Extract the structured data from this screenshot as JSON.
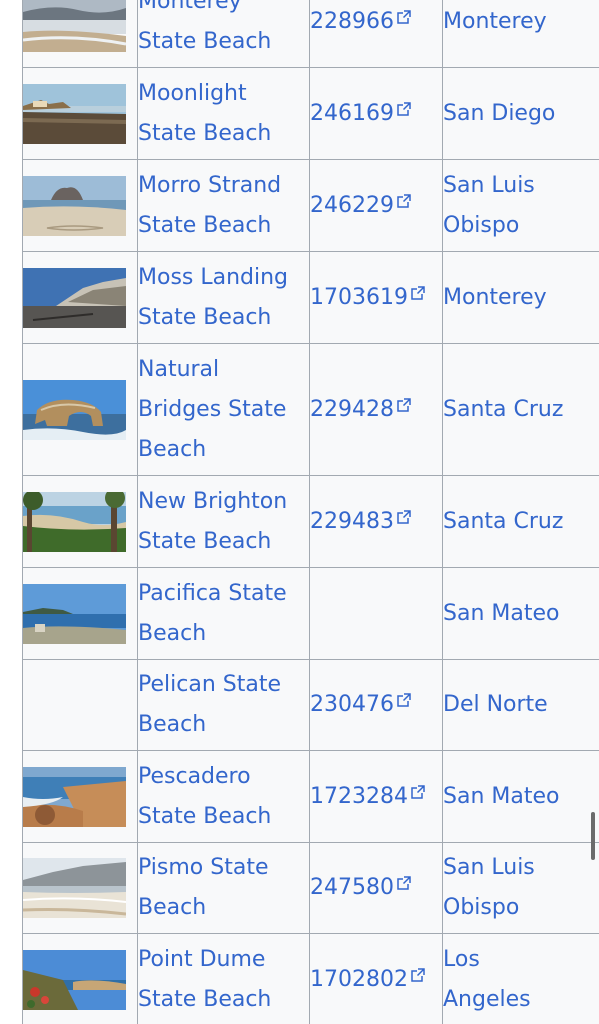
{
  "table": {
    "rows": [
      {
        "name": "Monterey State Beach",
        "name_lines": [
          "Monterey",
          "State Beach"
        ],
        "id": "228966",
        "county_lines": [
          "Monterey"
        ],
        "image": "monterey-beach-photo"
      },
      {
        "name": "Moonlight State Beach",
        "name_lines": [
          "Moonlight",
          "State Beach"
        ],
        "id": "246169",
        "county_lines": [
          "San Diego"
        ],
        "image": "moonlight-beach-photo"
      },
      {
        "name": "Morro Strand State Beach",
        "name_lines": [
          "Morro Strand",
          "State Beach"
        ],
        "id": "246229",
        "county_lines": [
          "San Luis",
          "Obispo"
        ],
        "image": "morro-strand-photo"
      },
      {
        "name": "Moss Landing State Beach",
        "name_lines": [
          "Moss Landing",
          "State Beach"
        ],
        "id": "1703619",
        "county_lines": [
          "Monterey"
        ],
        "image": "moss-landing-photo"
      },
      {
        "name": "Natural Bridges State Beach",
        "name_lines": [
          "Natural",
          "Bridges State",
          "Beach"
        ],
        "id": "229428",
        "county_lines": [
          "Santa Cruz"
        ],
        "image": "natural-bridges-photo"
      },
      {
        "name": "New Brighton State Beach",
        "name_lines": [
          "New Brighton",
          "State Beach"
        ],
        "id": "229483",
        "county_lines": [
          "Santa Cruz"
        ],
        "image": "new-brighton-photo"
      },
      {
        "name": "Pacifica State Beach",
        "name_lines": [
          "Pacifica State",
          "Beach"
        ],
        "id": "",
        "county_lines": [
          "San Mateo"
        ],
        "image": "pacifica-photo"
      },
      {
        "name": "Pelican State Beach",
        "name_lines": [
          "Pelican State",
          "Beach"
        ],
        "id": "230476",
        "county_lines": [
          "Del Norte"
        ],
        "image": ""
      },
      {
        "name": "Pescadero State Beach",
        "name_lines": [
          "Pescadero",
          "State Beach"
        ],
        "id": "1723284",
        "county_lines": [
          "San Mateo"
        ],
        "image": "pescadero-photo"
      },
      {
        "name": "Pismo State Beach",
        "name_lines": [
          "Pismo State",
          "Beach"
        ],
        "id": "247580",
        "county_lines": [
          "San Luis",
          "Obispo"
        ],
        "image": "pismo-photo"
      },
      {
        "name": "Point Dume State Beach",
        "name_lines": [
          "Point Dume",
          "State Beach"
        ],
        "id": "1702802",
        "county_lines": [
          "Los",
          "Angeles"
        ],
        "image": "point-dume-photo"
      }
    ]
  },
  "colors": {
    "link": "#3366cc",
    "cell_background": "#f8f9fa",
    "border": "#a2a9b1",
    "scrollbar": "#6b6b6b"
  }
}
